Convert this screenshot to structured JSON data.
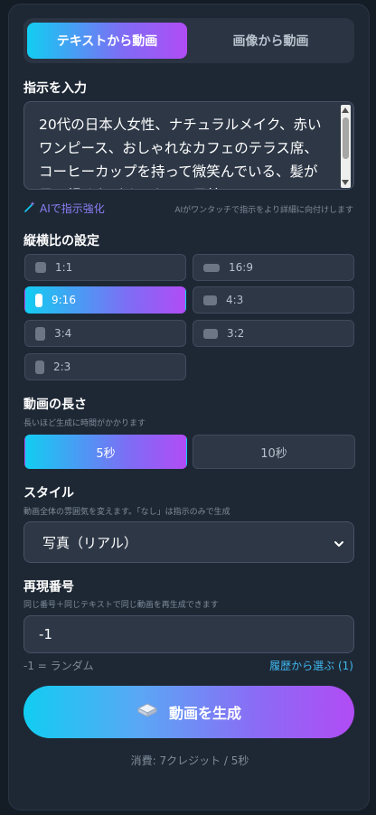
{
  "tabs": [
    {
      "label": "テキストから動画",
      "active": true
    },
    {
      "label": "画像から動画",
      "active": false
    }
  ],
  "prompt": {
    "label": "指示を入力",
    "value": "20代の日本人女性、ナチュラルメイク、赤いワンピース、おしゃれなカフェのテラス席、コーヒーカップを持って微笑んでいる、髪が風に軽くなびく、カメラ目線"
  },
  "enhance": {
    "label": "AIで指示強化",
    "note": "AIがワンタッチで指示をより詳細に向付けします"
  },
  "aspect": {
    "label": "縦横比の設定",
    "options": [
      {
        "label": "1:1",
        "active": false
      },
      {
        "label": "16:9",
        "active": false
      },
      {
        "label": "9:16",
        "active": true
      },
      {
        "label": "4:3",
        "active": false
      },
      {
        "label": "3:4",
        "active": false
      },
      {
        "label": "3:2",
        "active": false
      },
      {
        "label": "2:3",
        "active": false
      }
    ]
  },
  "duration": {
    "label": "動画の長さ",
    "sub": "長いほど生成に時間がかかります",
    "options": [
      {
        "label": "5秒",
        "active": true
      },
      {
        "label": "10秒",
        "active": false
      }
    ]
  },
  "style": {
    "label": "スタイル",
    "sub": "動画全体の雰囲気を変えます。「なし」は指示のみで生成",
    "selected": "写真（リアル）"
  },
  "seed": {
    "label": "再現番号",
    "sub": "同じ番号＋同じテキストで同じ動画を再生成できます",
    "value": "-1",
    "hint": "-1 = ランダム",
    "history_link": "履歴から選ぶ (1)"
  },
  "generate": {
    "label": "動画を生成",
    "icon": "cube-icon"
  },
  "cost": "消費: 7クレジット / 5秒",
  "colors": {
    "accent_start": "#12cdf2",
    "accent_end": "#b14cf5",
    "panel": "#1e2835",
    "background": "#141c26"
  }
}
